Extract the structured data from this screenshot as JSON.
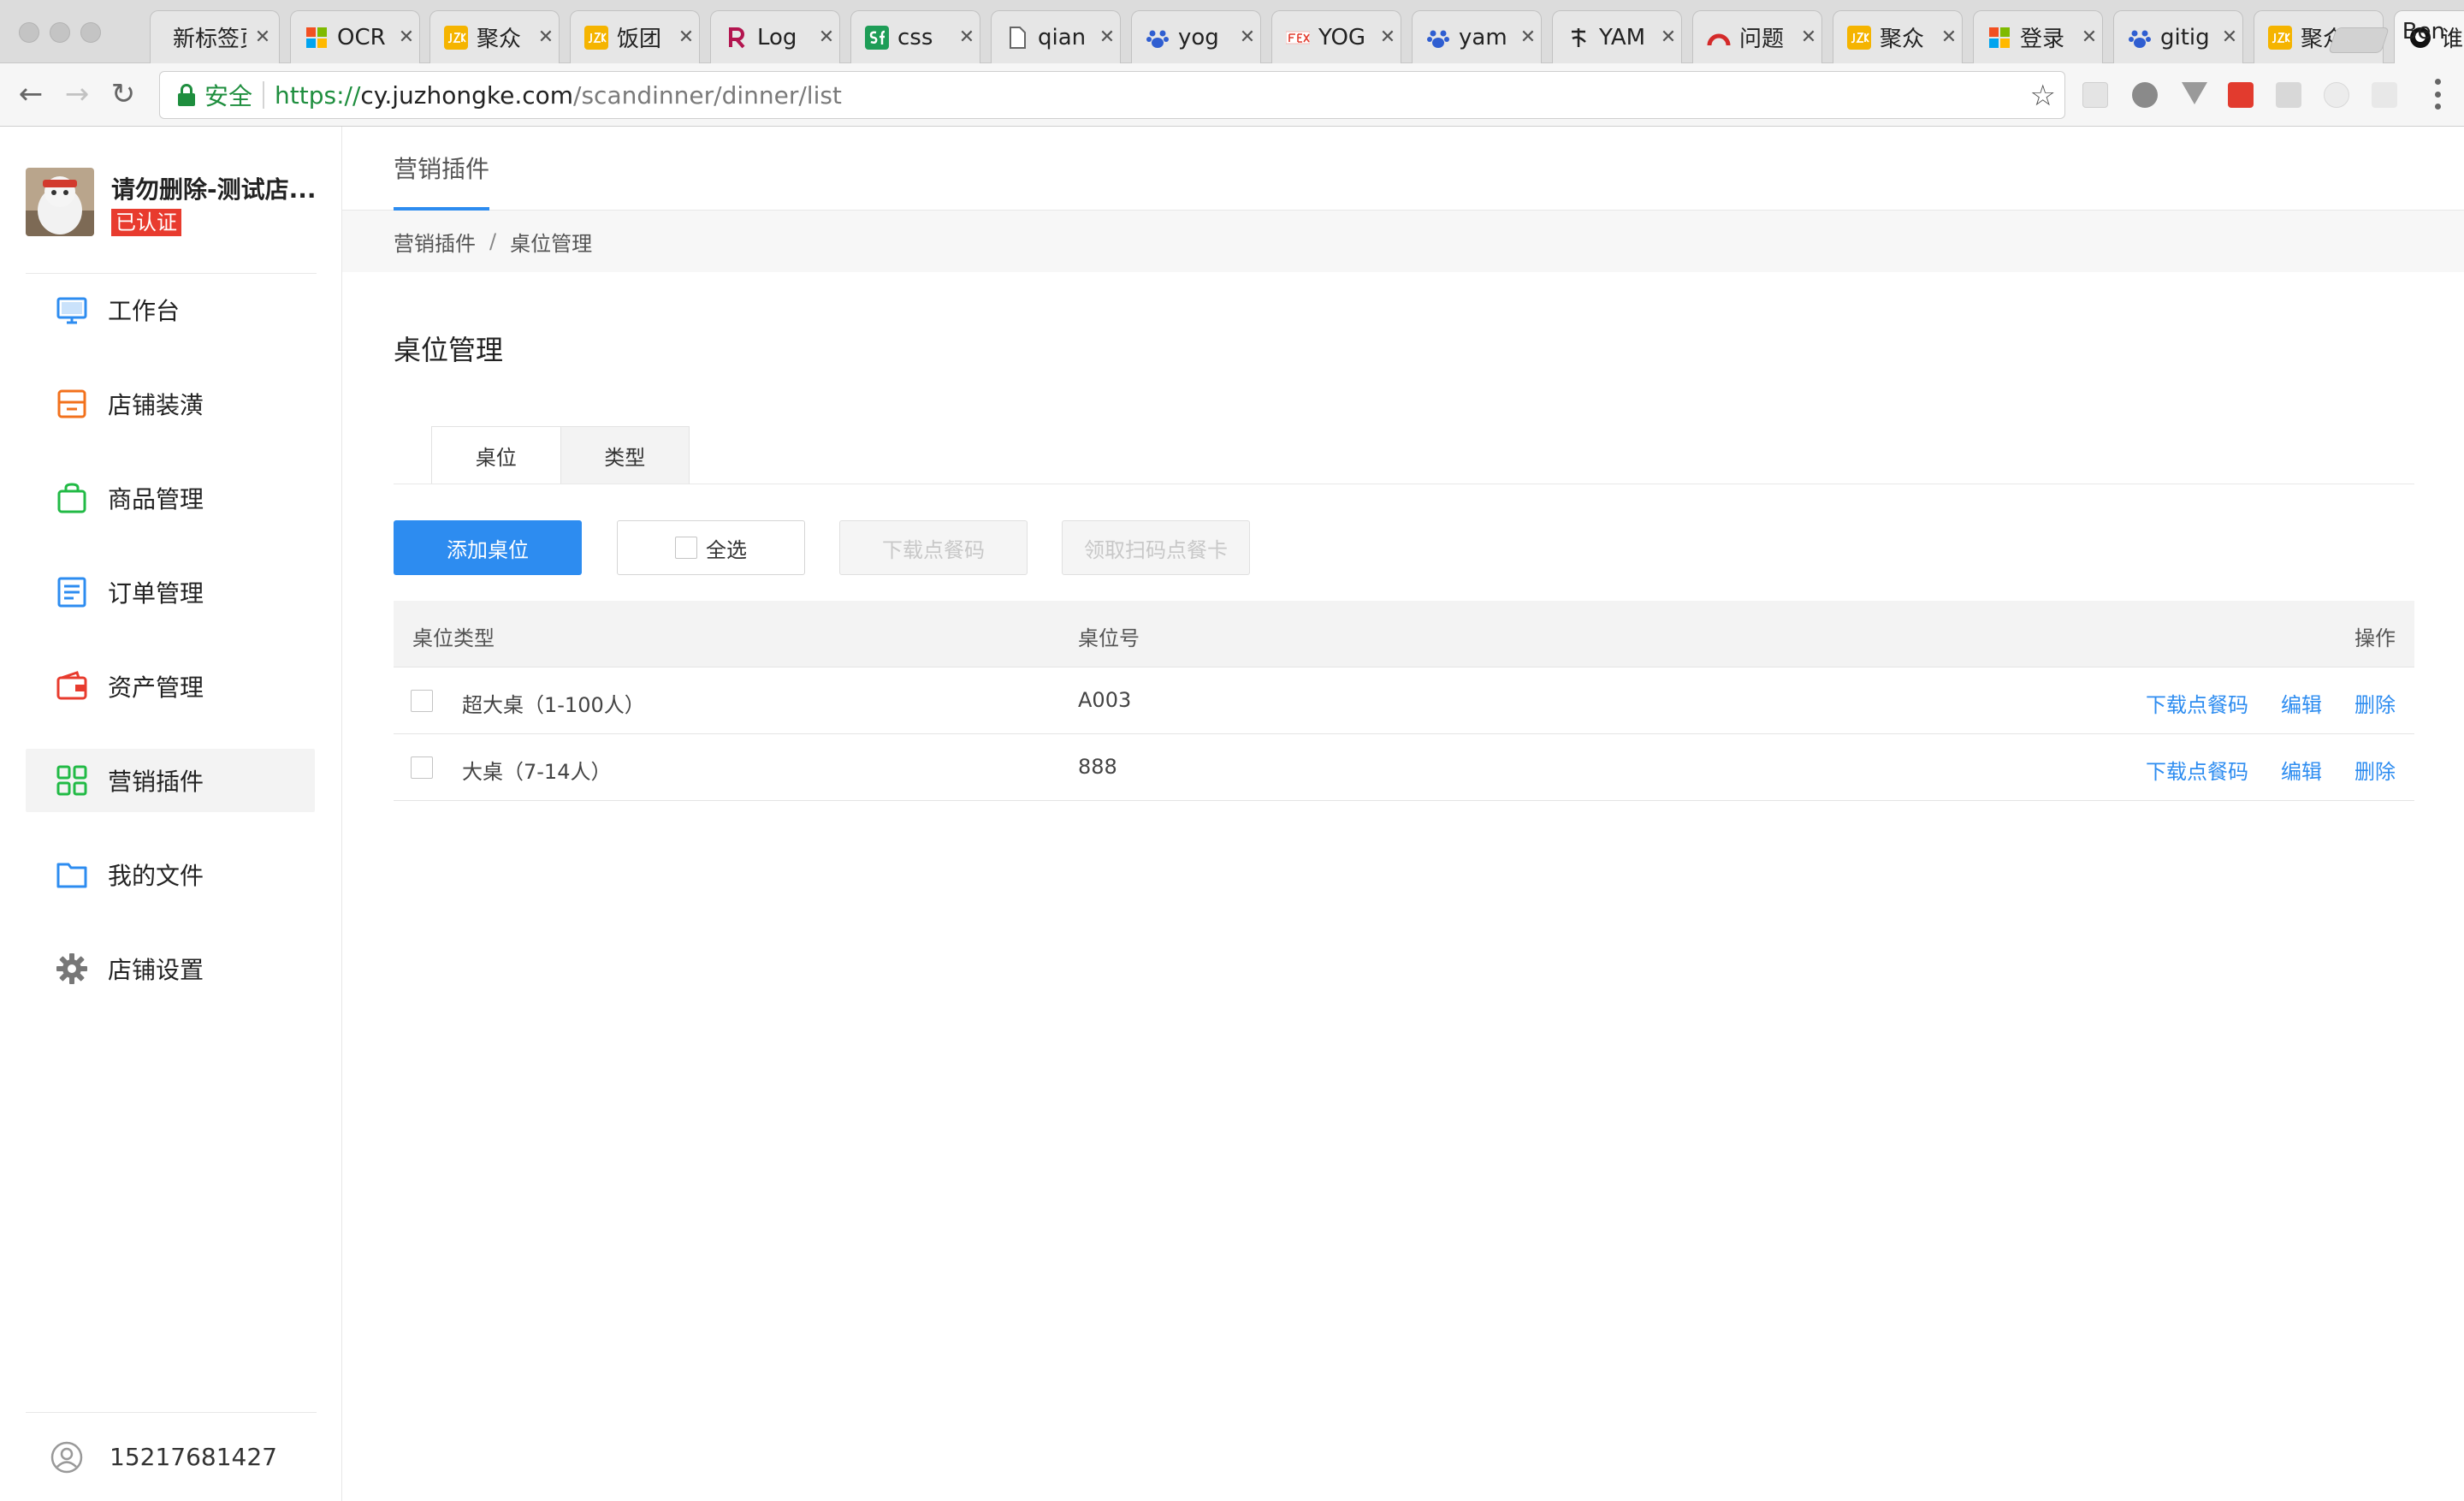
{
  "browser": {
    "tabs": [
      {
        "title": "新标签页",
        "favicon": "blank-icon",
        "color": ""
      },
      {
        "title": "OCR",
        "favicon": "microsoft-icon",
        "color": ""
      },
      {
        "title": "聚众",
        "favicon": "jzk-icon",
        "color": "#f5b400"
      },
      {
        "title": "饭团",
        "favicon": "jzk-icon",
        "color": "#f5b400"
      },
      {
        "title": "Log",
        "favicon": "r-icon",
        "color": "#b3154f"
      },
      {
        "title": "css",
        "favicon": "sf-icon",
        "color": "#1e9d57"
      },
      {
        "title": "qian",
        "favicon": "page-icon",
        "color": ""
      },
      {
        "title": "yog",
        "favicon": "paw-icon",
        "color": "#2f5ed1"
      },
      {
        "title": "YOG",
        "favicon": "fex-icon",
        "color": "#e23b2e"
      },
      {
        "title": "yam",
        "favicon": "paw-icon",
        "color": "#2f5ed1"
      },
      {
        "title": "YAM",
        "favicon": "calligraphy-icon",
        "color": "#222222"
      },
      {
        "title": "问题",
        "favicon": "arc-icon",
        "color": "#d42a2a"
      },
      {
        "title": "聚众",
        "favicon": "jzk-icon",
        "color": "#f5b400"
      },
      {
        "title": "登录",
        "favicon": "microsoft-icon",
        "color": ""
      },
      {
        "title": "gitig",
        "favicon": "paw-icon",
        "color": "#2f5ed1"
      },
      {
        "title": "聚众",
        "favicon": "jzk-icon",
        "color": "#f5b400"
      },
      {
        "title": "谁在",
        "favicon": "github-icon",
        "color": "#111111"
      }
    ],
    "profile_name": "Ben",
    "security_label": "安全",
    "url": {
      "scheme": "https://",
      "host": "cy.juzhongke.com",
      "path": "/scandinner/dinner/list"
    }
  },
  "sidebar": {
    "shop_name": "请勿删除-测试店...",
    "verified_badge": "已认证",
    "items": [
      {
        "label": "工作台",
        "icon": "monitor-icon",
        "color": "#2d8cf0"
      },
      {
        "label": "店铺装潢",
        "icon": "store-icon",
        "color": "#f2711c"
      },
      {
        "label": "商品管理",
        "icon": "bag-icon",
        "color": "#21ba45"
      },
      {
        "label": "订单管理",
        "icon": "list-icon",
        "color": "#2d8cf0"
      },
      {
        "label": "资产管理",
        "icon": "wallet-icon",
        "color": "#e83b2e"
      },
      {
        "label": "营销插件",
        "icon": "apps-icon",
        "color": "#21ba45"
      },
      {
        "label": "我的文件",
        "icon": "folder-icon",
        "color": "#2d8cf0"
      },
      {
        "label": "店铺设置",
        "icon": "gear-icon",
        "color": "#777777"
      }
    ],
    "active_index": 5,
    "user_phone": "15217681427"
  },
  "main": {
    "top_tab": "营销插件",
    "breadcrumb": [
      "营销插件",
      "桌位管理"
    ],
    "breadcrumb_sep": "/",
    "title": "桌位管理",
    "segments": [
      "桌位",
      "类型"
    ],
    "buttons": {
      "add": "添加桌位",
      "select_all": "全选",
      "download": "下载点餐码",
      "claim": "领取扫码点餐卡"
    },
    "table": {
      "headers": [
        "桌位类型",
        "桌位号",
        "操作"
      ],
      "rows": [
        {
          "type": "超大桌（1-100人）",
          "number": "A003"
        },
        {
          "type": "大桌（7-14人）",
          "number": "888"
        }
      ],
      "actions": [
        "下载点餐码",
        "编辑",
        "删除"
      ]
    },
    "accent_color": "#2d8cf0"
  }
}
